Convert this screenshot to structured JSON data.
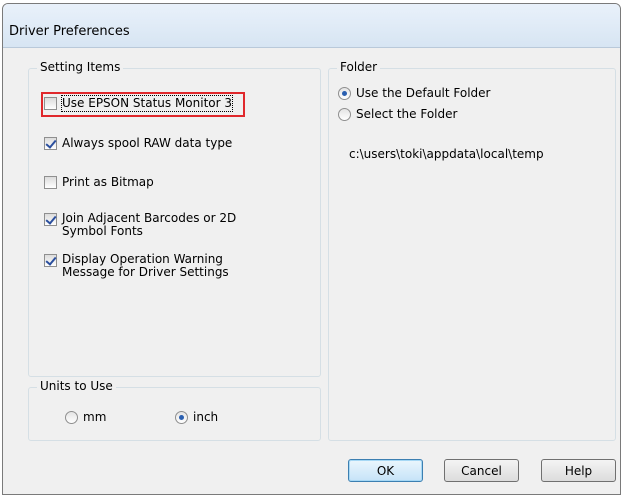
{
  "window": {
    "title": "Driver Preferences"
  },
  "setting_items": {
    "legend": "Setting Items",
    "items": [
      {
        "label": "Use EPSON Status Monitor 3",
        "checked": false,
        "highlighted": true
      },
      {
        "label": "Always spool RAW data type",
        "checked": true
      },
      {
        "label": "Print as Bitmap",
        "checked": false
      },
      {
        "label_line1": "Join Adjacent Barcodes or 2D",
        "label_line2": "Symbol Fonts",
        "checked": true
      },
      {
        "label_line1": "Display Operation Warning",
        "label_line2": "Message for Driver Settings",
        "checked": true
      }
    ]
  },
  "units": {
    "legend": "Units to Use",
    "options": [
      {
        "label": "mm",
        "selected": false
      },
      {
        "label": "inch",
        "selected": true
      }
    ]
  },
  "folder": {
    "legend": "Folder",
    "options": [
      {
        "label": "Use the Default Folder",
        "selected": true
      },
      {
        "label": "Select the Folder",
        "selected": false
      }
    ],
    "path": "c:\\users\\toki\\appdata\\local\\temp"
  },
  "buttons": {
    "ok": "OK",
    "cancel": "Cancel",
    "help": "Help"
  },
  "colors": {
    "highlight": "#e0282c",
    "accent": "#2a5fb0"
  }
}
